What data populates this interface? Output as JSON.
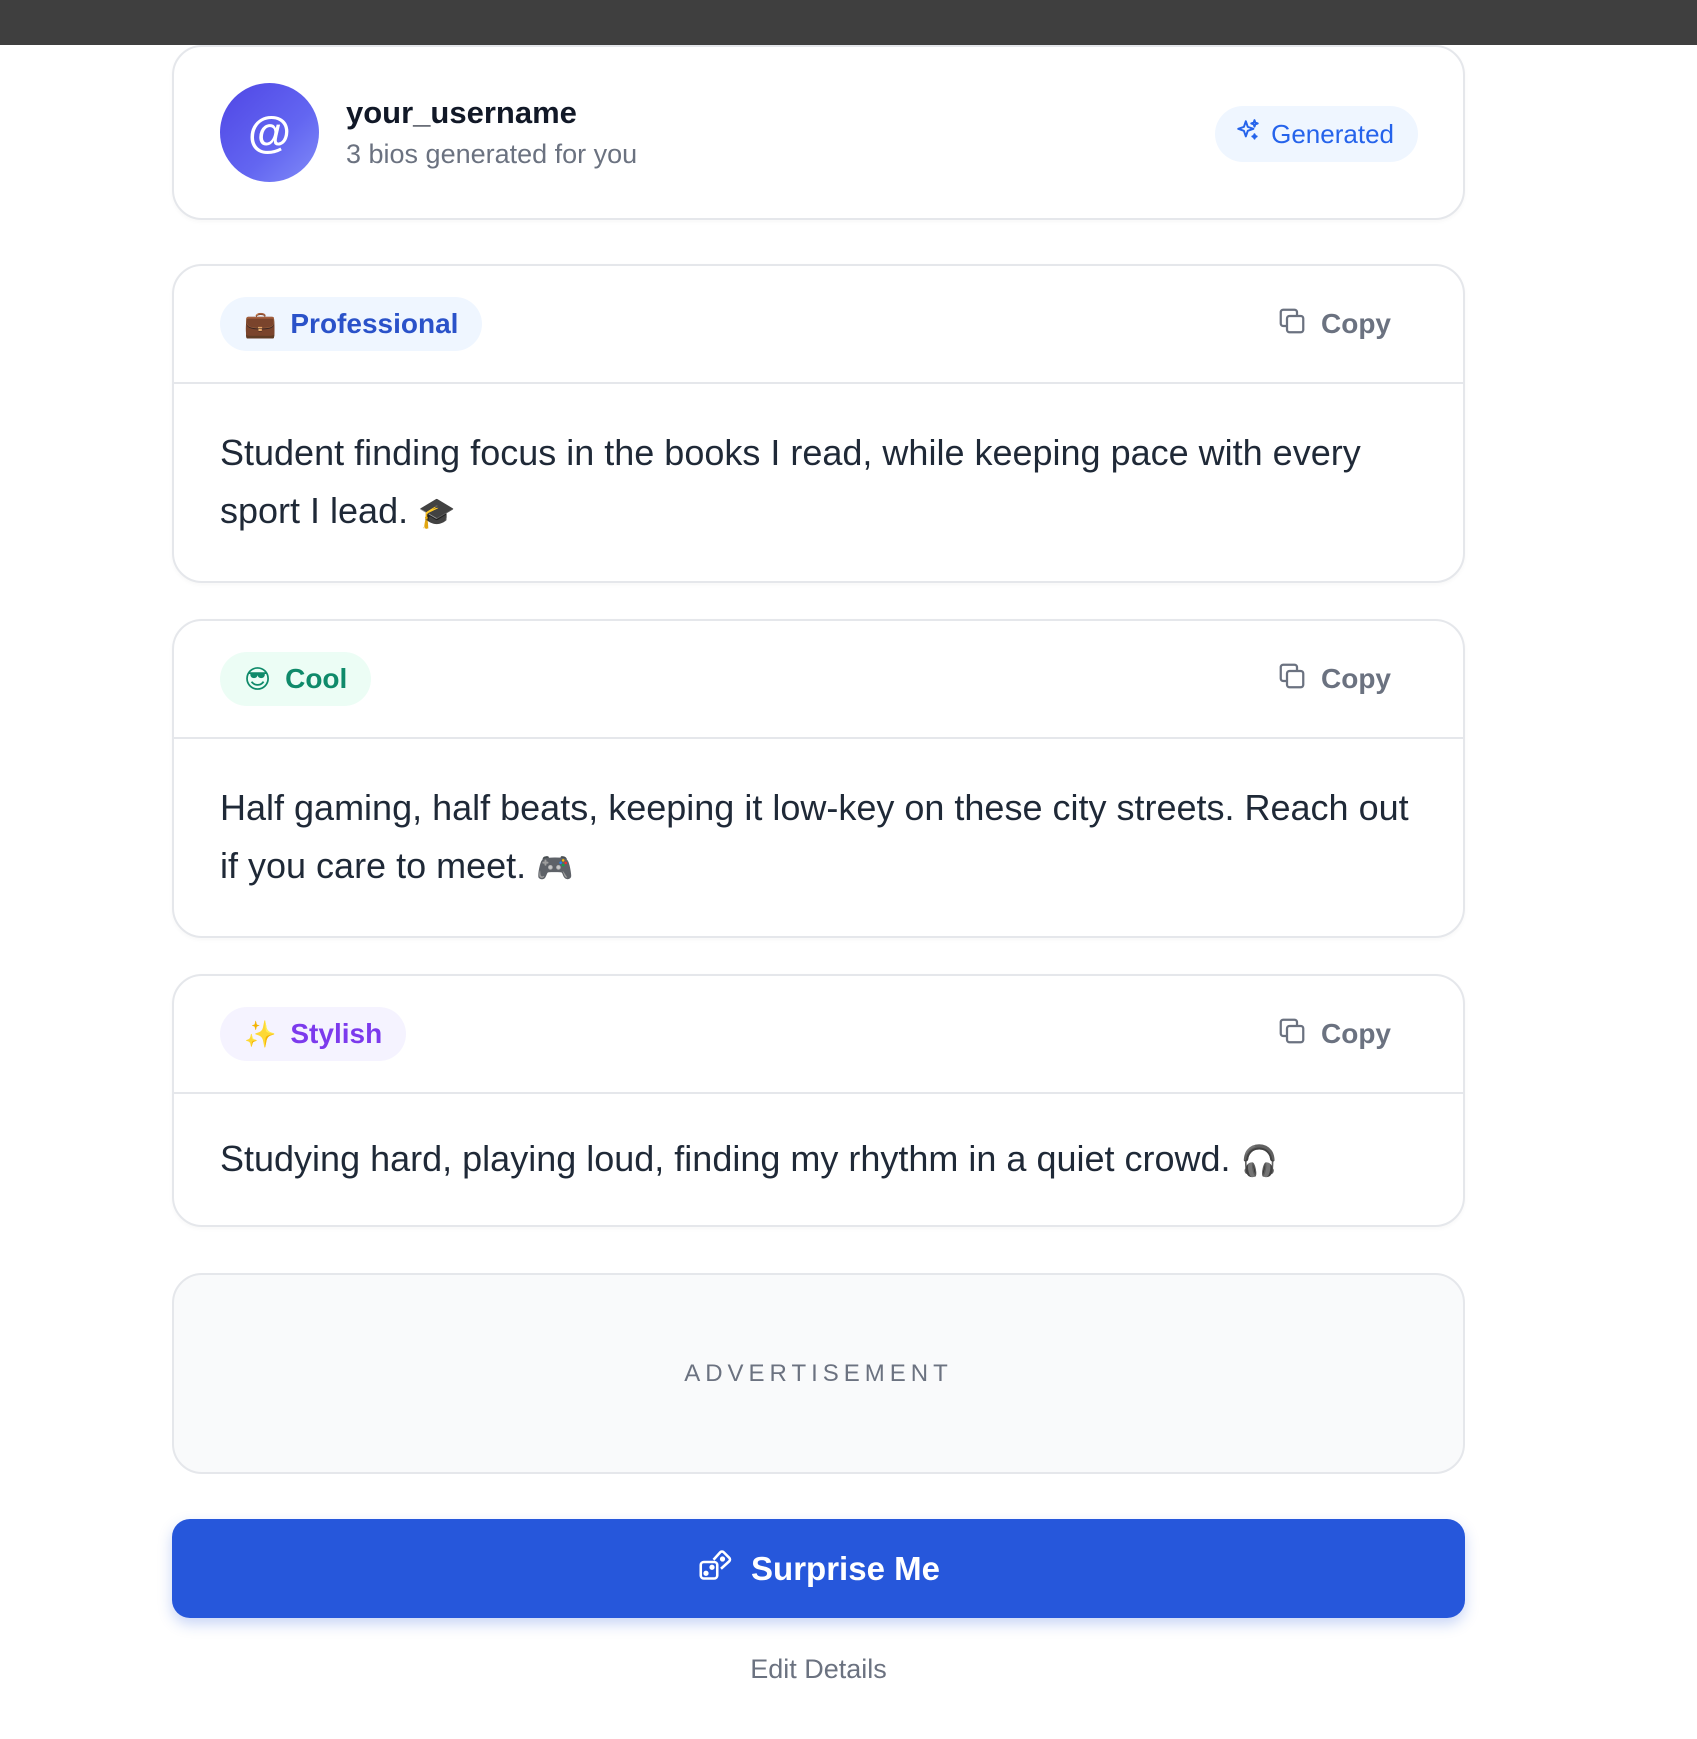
{
  "header": {
    "avatar_symbol": "@",
    "username": "your_username",
    "subtitle": "3 bios generated for you",
    "badge_label": "Generated",
    "badge_icon": "sparkles-icon"
  },
  "bios": [
    {
      "tag_label": "Professional",
      "tag_emoji": "💼",
      "copy_label": "Copy",
      "text": "Student finding focus in the books I read, while keeping pace with every sport I lead.",
      "text_emoji": "🎓"
    },
    {
      "tag_label": "Cool",
      "tag_emoji": "😎",
      "copy_label": "Copy",
      "text": "Half gaming, half beats, keeping it low-key on these city streets. Reach out if you care to meet.",
      "text_emoji": "🎮"
    },
    {
      "tag_label": "Stylish",
      "tag_emoji": "✨",
      "copy_label": "Copy",
      "text": "Studying hard, playing loud, finding my rhythm in a quiet crowd.",
      "text_emoji": "🎧"
    }
  ],
  "ad_label": "ADVERTISEMENT",
  "surprise_label": "Surprise Me",
  "edit_label": "Edit Details",
  "colors": {
    "primary": "#2657db",
    "avatar_gradient_start": "#4f46e5",
    "topbar": "#3f3f3f"
  }
}
